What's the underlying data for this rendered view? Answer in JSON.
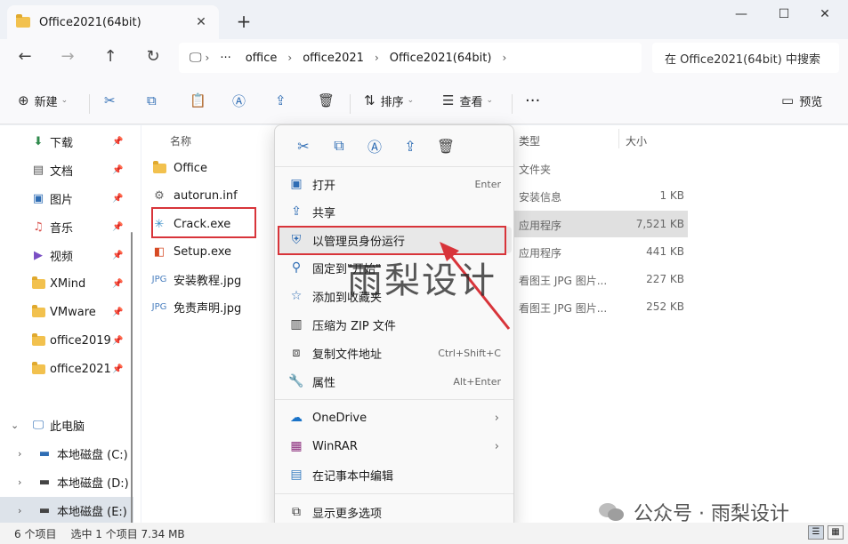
{
  "window": {
    "tab_title": "Office2021(64bit)",
    "new_tab": "+",
    "minimize": "—",
    "maximize": "☐",
    "close": "✕"
  },
  "address": {
    "more": "···",
    "segments": [
      "office",
      "office2021",
      "Office2021(64bit)"
    ],
    "search_placeholder": "在 Office2021(64bit) 中搜索"
  },
  "toolbar": {
    "new_label": "新建",
    "sort_label": "排序",
    "view_label": "查看",
    "more": "···",
    "preview_label": "预览"
  },
  "navpane": {
    "quick": [
      {
        "label": "下载",
        "icon": "download-icon"
      },
      {
        "label": "文档",
        "icon": "document-icon"
      },
      {
        "label": "图片",
        "icon": "picture-icon"
      },
      {
        "label": "音乐",
        "icon": "music-icon"
      },
      {
        "label": "视频",
        "icon": "video-icon"
      },
      {
        "label": "XMind",
        "icon": "folder-icon"
      },
      {
        "label": "VMware",
        "icon": "folder-icon"
      },
      {
        "label": "office2019",
        "icon": "folder-icon"
      },
      {
        "label": "office2021",
        "icon": "folder-icon"
      }
    ],
    "this_pc": "此电脑",
    "drives": [
      "本地磁盘 (C:)",
      "本地磁盘 (D:)",
      "本地磁盘 (E:)"
    ]
  },
  "columns": {
    "name": "名称",
    "type": "类型",
    "size": "大小"
  },
  "files": [
    {
      "name": "Office",
      "type": "文件夹",
      "size": "",
      "icon": "folder-icon"
    },
    {
      "name": "autorun.inf",
      "type": "安装信息",
      "size": "1 KB",
      "icon": "settings-file-icon"
    },
    {
      "name": "Crack.exe",
      "type": "应用程序",
      "size": "7,521 KB",
      "icon": "crack-app-icon"
    },
    {
      "name": "Setup.exe",
      "type": "应用程序",
      "size": "441 KB",
      "icon": "office-app-icon"
    },
    {
      "name": "安装教程.jpg",
      "type": "看图王 JPG 图片...",
      "size": "227 KB",
      "icon": "jpg-icon"
    },
    {
      "name": "免责声明.jpg",
      "type": "看图王 JPG 图片...",
      "size": "252 KB",
      "icon": "jpg-icon"
    }
  ],
  "context_menu": {
    "items": [
      {
        "label": "打开",
        "shortcut": "Enter",
        "icon": "open-icon"
      },
      {
        "label": "共享",
        "shortcut": "",
        "icon": "share-icon"
      },
      {
        "label": "以管理员身份运行",
        "shortcut": "",
        "icon": "shield-icon"
      },
      {
        "label": "固定到\"开始\"",
        "shortcut": "",
        "icon": "pin-icon"
      },
      {
        "label": "添加到收藏夹",
        "shortcut": "",
        "icon": "star-icon"
      },
      {
        "label": "压缩为 ZIP 文件",
        "shortcut": "",
        "icon": "zip-icon"
      },
      {
        "label": "复制文件地址",
        "shortcut": "Ctrl+Shift+C",
        "icon": "copy-path-icon"
      },
      {
        "label": "属性",
        "shortcut": "Alt+Enter",
        "icon": "wrench-icon"
      },
      {
        "label": "OneDrive",
        "shortcut": "",
        "icon": "onedrive-icon"
      },
      {
        "label": "WinRAR",
        "shortcut": "",
        "icon": "winrar-icon"
      },
      {
        "label": "在记事本中编辑",
        "shortcut": "",
        "icon": "notepad-icon"
      },
      {
        "label": "显示更多选项",
        "shortcut": "",
        "icon": "more-options-icon"
      }
    ]
  },
  "watermark": "雨梨设计",
  "status": {
    "count": "6 个项目",
    "selected": "选中 1 个项目  7.34 MB"
  },
  "wechat_label": "公众号 · 雨梨设计",
  "colors": {
    "accent": "#2f6db4",
    "highlight_red": "#d8343a",
    "folder": "#f2c14e"
  }
}
